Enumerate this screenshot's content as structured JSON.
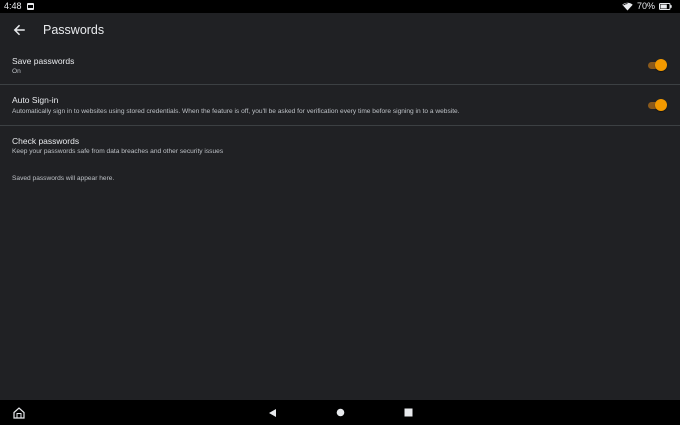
{
  "status_bar": {
    "time": "4:48",
    "battery_percent": "70%",
    "battery_level": 0.7
  },
  "app_bar": {
    "title": "Passwords"
  },
  "settings": {
    "save_passwords": {
      "title": "Save passwords",
      "subtitle": "On",
      "enabled": true
    },
    "auto_sign_in": {
      "title": "Auto Sign-in",
      "subtitle": "Automatically sign in to websites using stored credentials. When the feature is off, you'll be asked for verification every time before signing in to a website.",
      "enabled": true
    },
    "check_passwords": {
      "title": "Check passwords",
      "subtitle": "Keep your passwords safe from data breaches and other security issues"
    }
  },
  "empty_state": {
    "message": "Saved passwords will appear here."
  },
  "colors": {
    "background": "#202124",
    "accent": "#f29900",
    "text_primary": "#e8eaed",
    "text_secondary": "#bdc1c6"
  },
  "icons": {
    "back": "arrow-left-icon",
    "home": "home-icon",
    "nav_back": "triangle-back-icon",
    "nav_home": "circle-home-icon",
    "nav_recents": "square-recents-icon",
    "wifi": "wifi-icon",
    "battery": "battery-icon"
  }
}
